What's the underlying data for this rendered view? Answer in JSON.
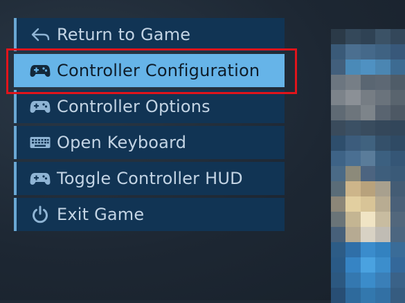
{
  "menu": {
    "items": [
      {
        "label": "Return to Game",
        "icon": "return-arrow-icon"
      },
      {
        "label": "Controller Configuration",
        "icon": "gamepad-icon",
        "selected": true
      },
      {
        "label": "Controller Options",
        "icon": "gamepad-icon"
      },
      {
        "label": "Open Keyboard",
        "icon": "keyboard-icon"
      },
      {
        "label": "Toggle Controller HUD",
        "icon": "gamepad-icon"
      },
      {
        "label": "Exit Game",
        "icon": "power-icon"
      }
    ]
  },
  "colors": {
    "menu_bg": "#113454",
    "selected_bg": "#66b4e8",
    "text": "#c3d4e4",
    "highlight_outline": "#e1141b"
  }
}
